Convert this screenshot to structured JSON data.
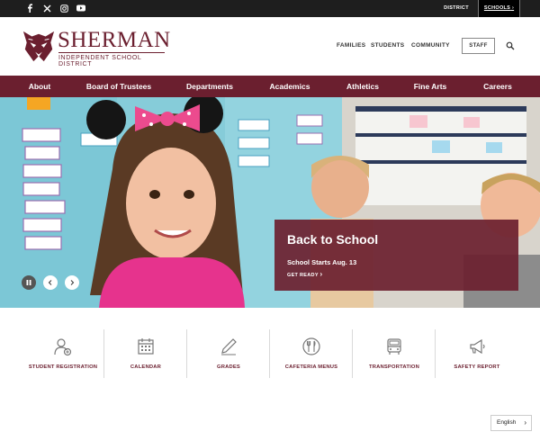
{
  "topbar": {
    "social": [
      "facebook-icon",
      "x-twitter-icon",
      "instagram-icon",
      "youtube-icon"
    ],
    "district_label": "DISTRICT",
    "schools_label": "SCHOOLS"
  },
  "header": {
    "logo_title": "SHERMAN",
    "logo_subtitle": "INDEPENDENT SCHOOL DISTRICT",
    "utility_links": [
      "FAMILIES",
      "STUDENTS",
      "COMMUNITY"
    ],
    "staff_label": "STAFF"
  },
  "nav": [
    "About",
    "Board of Trustees",
    "Departments",
    "Academics",
    "Athletics",
    "Fine Arts",
    "Careers"
  ],
  "hero": {
    "caption_title": "Back to School",
    "caption_text": "School Starts Aug. 13",
    "caption_link": "GET READY"
  },
  "quick_links": [
    {
      "label": "STUDENT REGISTRATION",
      "icon": "user-add-icon"
    },
    {
      "label": "CALENDAR",
      "icon": "calendar-icon"
    },
    {
      "label": "GRADES",
      "icon": "pencil-icon"
    },
    {
      "label": "CAFETERIA MENUS",
      "icon": "utensils-icon"
    },
    {
      "label": "TRANSPORTATION",
      "icon": "bus-icon"
    },
    {
      "label": "SAFETY REPORT",
      "icon": "megaphone-icon"
    }
  ],
  "language": "English",
  "colors": {
    "brand": "#6b1f2f",
    "topbar": "#1e1e1e"
  }
}
